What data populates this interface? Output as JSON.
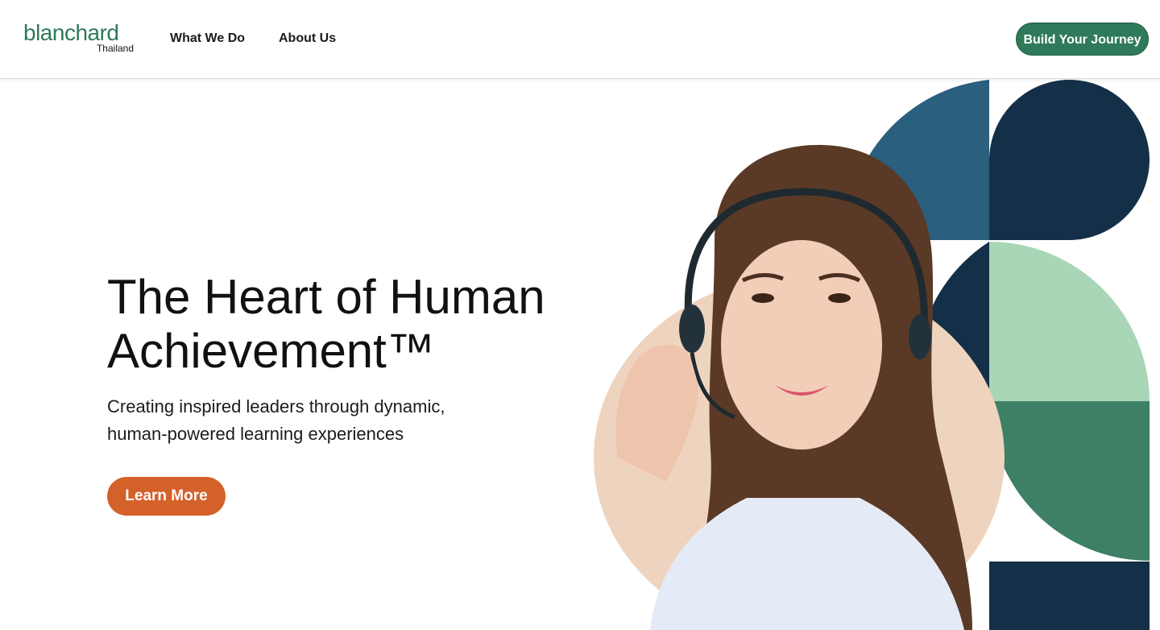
{
  "header": {
    "logo": {
      "wordmark": "blanchard",
      "region": "Thailand"
    },
    "nav": [
      {
        "label": "What We Do"
      },
      {
        "label": "About Us"
      }
    ],
    "cta_label": "Build Your Journey"
  },
  "hero": {
    "title": "The Heart of Human Achievement™",
    "subtitle": "Creating inspired leaders through dynamic, human-powered learning experiences",
    "button_label": "Learn More"
  },
  "colors": {
    "brand_green": "#2f7a5a",
    "accent_orange": "#d4612a",
    "navy": "#133048",
    "steel_blue": "#2a5f7e",
    "mint": "#a9d6b6",
    "forest": "#3d8065",
    "photo_backdrop": "#eed4bf"
  }
}
